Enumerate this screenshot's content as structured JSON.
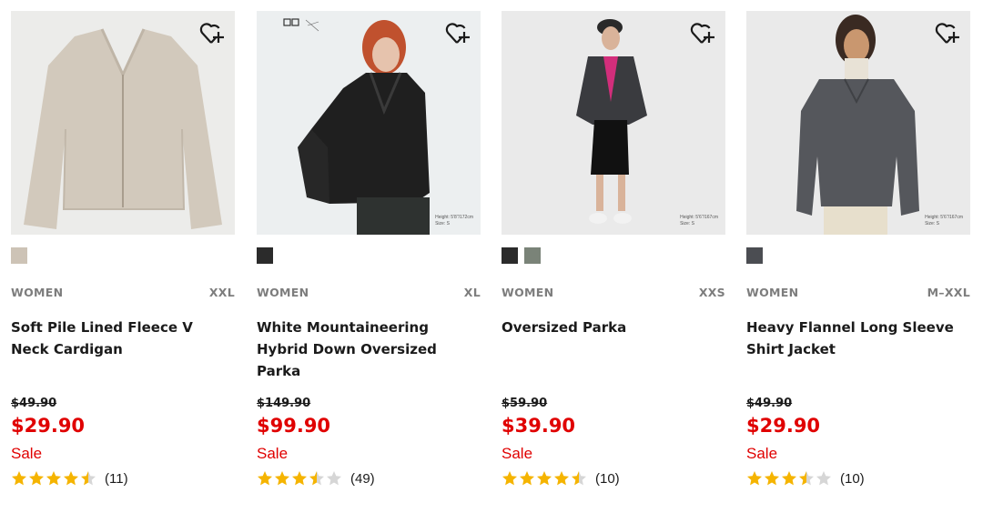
{
  "products": [
    {
      "colors": [
        "#cdc3b6"
      ],
      "gender": "WOMEN",
      "size": "XXL",
      "name": "Soft Pile Lined Fleece V Neck Cardigan",
      "original_price": "$49.90",
      "sale_price": "$29.90",
      "sale_label": "Sale",
      "rating": 4.5,
      "review_count": "(11)",
      "favorite_icon": "heart-plus-icon"
    },
    {
      "colors": [
        "#2b2b2b"
      ],
      "gender": "WOMEN",
      "size": "XL",
      "name": "White Mountaineering Hybrid Down Oversized Parka",
      "original_price": "$149.90",
      "sale_price": "$99.90",
      "sale_label": "Sale",
      "rating": 3.5,
      "review_count": "(49)",
      "brand_mark": "White Mountaineering",
      "model_info": [
        "Height: 5'8\"/172cm",
        "Size: S"
      ],
      "favorite_icon": "heart-plus-icon"
    },
    {
      "colors": [
        "#2b2b2b",
        "#7a8378"
      ],
      "gender": "WOMEN",
      "size": "XXS",
      "name": "Oversized Parka",
      "original_price": "$59.90",
      "sale_price": "$39.90",
      "sale_label": "Sale",
      "rating": 4.5,
      "review_count": "(10)",
      "model_info": [
        "Height: 5'6\"/167cm",
        "Size: S"
      ],
      "favorite_icon": "heart-plus-icon"
    },
    {
      "colors": [
        "#4b4d52"
      ],
      "gender": "WOMEN",
      "size": "M–XXL",
      "name": "Heavy Flannel Long Sleeve Shirt Jacket",
      "original_price": "$49.90",
      "sale_price": "$29.90",
      "sale_label": "Sale",
      "rating": 3.5,
      "review_count": "(10)",
      "model_info": [
        "Height: 5'6\"/167cm",
        "Size: S"
      ],
      "favorite_icon": "heart-plus-icon"
    }
  ],
  "theme": {
    "sale_color": "#e00000",
    "star_color": "#f5b400",
    "star_empty_color": "#d6d6d6",
    "photo_bg": "#ececec"
  }
}
